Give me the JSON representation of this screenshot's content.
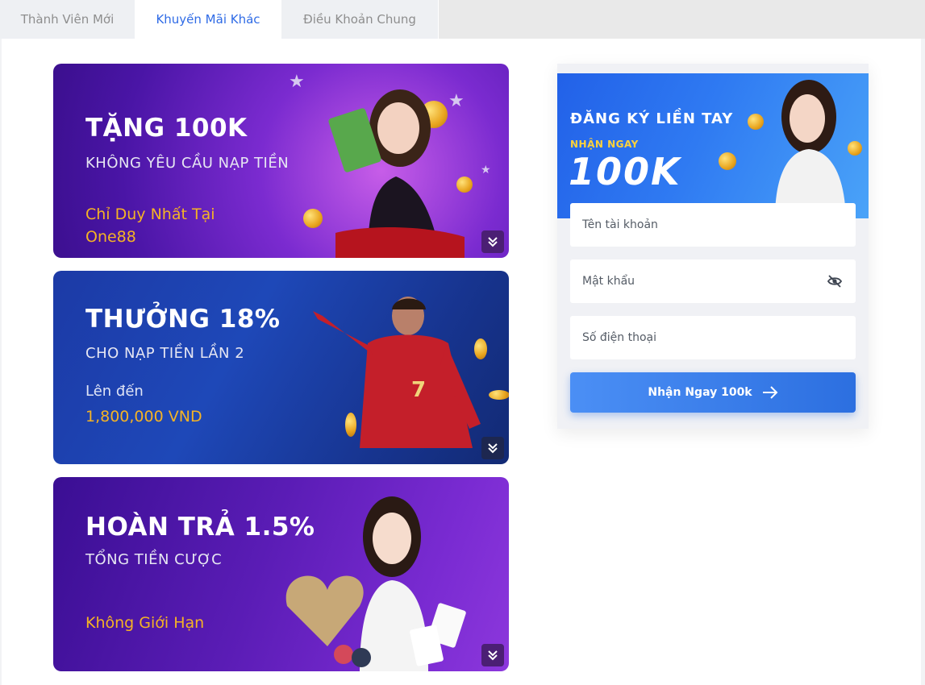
{
  "tabs": [
    {
      "label": "Thành Viên Mới",
      "active": false
    },
    {
      "label": "Khuyến Mãi Khác",
      "active": true
    },
    {
      "label": "Điều Khoản Chung",
      "active": false
    }
  ],
  "banners": [
    {
      "title": "TẶNG 100K",
      "subtitle": "KHÔNG YÊU CẦU NẠP TIỀN",
      "line1": "Chỉ Duy Nhất Tại",
      "line2": "One88"
    },
    {
      "title": "THƯỞNG 18%",
      "subtitle": "CHO NẠP TIỀN LẦN 2",
      "line1": "Lên đến",
      "line2": "1,800,000 VND"
    },
    {
      "title": "HOÀN TRẢ 1.5%",
      "subtitle": "TỔNG TIỀN CƯỢC",
      "line1": "Không Giới Hạn"
    }
  ],
  "signup": {
    "hero": {
      "line1": "ĐĂNG KÝ LIỀN TAY",
      "line2": "NHẬN NGAY",
      "line3": "100K"
    },
    "username_placeholder": "Tên tài khoản",
    "password_placeholder": "Mật khẩu",
    "phone_placeholder": "Số điện thoại",
    "submit_label": "Nhận Ngay 100k"
  },
  "colors": {
    "accent": "#2f6be6",
    "gold": "#f5b325",
    "tab_bg": "#eef0f3"
  },
  "icons": [
    "chevron-double-down-icon",
    "eye-slash-icon",
    "arrow-right-icon"
  ]
}
